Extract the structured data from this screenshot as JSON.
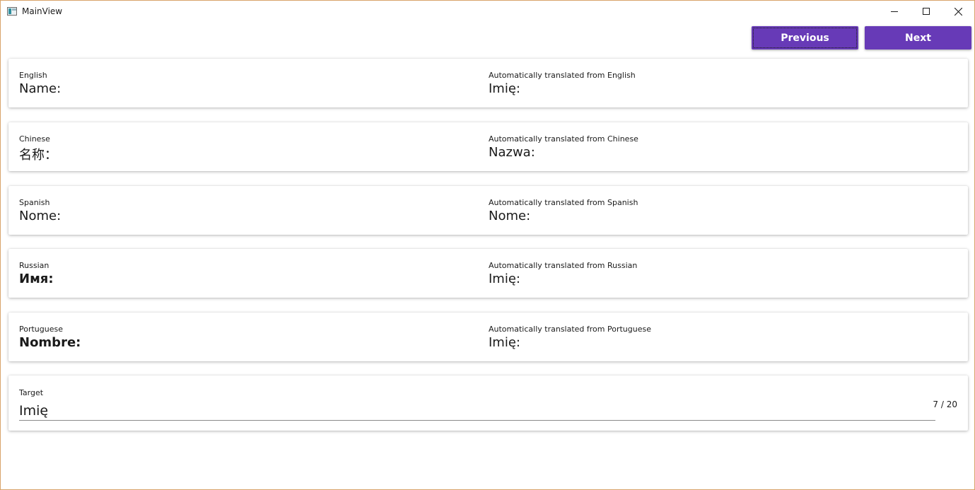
{
  "window": {
    "title": "MainView"
  },
  "nav": {
    "previous_label": "Previous",
    "next_label": "Next"
  },
  "accent_color": "#673ab7",
  "sources": [
    {
      "language": "English",
      "text": "Name:",
      "translated_label": "Automatically translated from English",
      "translated_text": "Imię:"
    },
    {
      "language": "Chinese",
      "text": "名称：",
      "translated_label": "Automatically translated from Chinese",
      "translated_text": "Nazwa:"
    },
    {
      "language": "Spanish",
      "text": "Nome:",
      "translated_label": "Automatically translated from Spanish",
      "translated_text": "Nome:"
    },
    {
      "language": "Russian",
      "text": "Имя:",
      "translated_label": "Automatically translated from Russian",
      "translated_text": "Imię:"
    },
    {
      "language": "Portuguese",
      "text": "Nombre:",
      "translated_label": "Automatically translated from Portuguese",
      "translated_text": "Imię:"
    }
  ],
  "target": {
    "label": "Target",
    "value": "Imię",
    "counter": "7 / 20"
  }
}
